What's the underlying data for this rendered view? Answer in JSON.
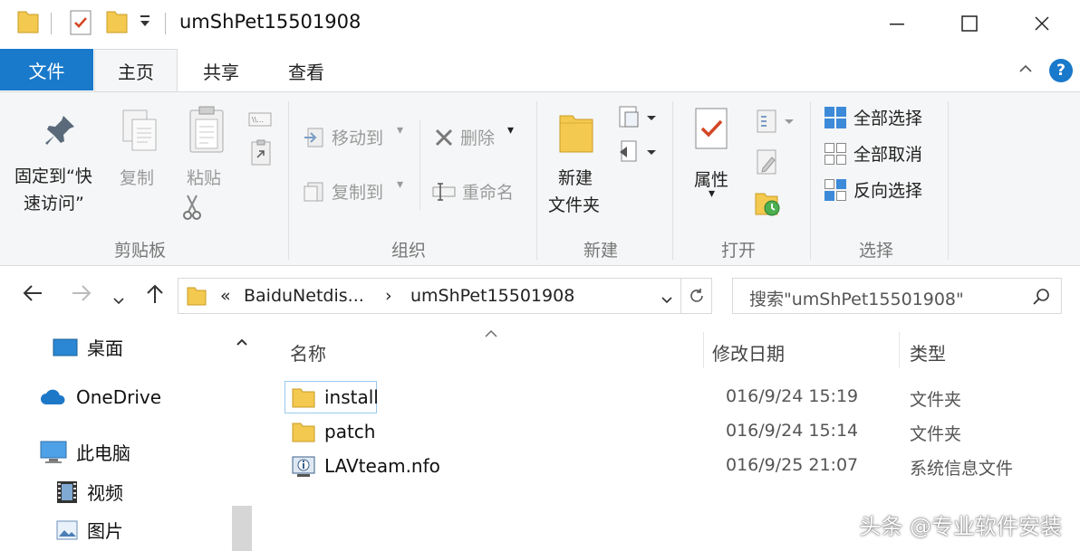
{
  "window": {
    "title": "umShPet15501908"
  },
  "ribbon_tabs": [
    "文件",
    "主页",
    "共享",
    "查看"
  ],
  "ribbon": {
    "clipboard": {
      "pin_label_1": "固定到“快",
      "pin_label_2": "速访问”",
      "copy_label": "复制",
      "paste_label": "粘贴",
      "group_label": "剪贴板"
    },
    "organize": {
      "move_to": "移动到",
      "copy_to": "复制到",
      "delete": "删除",
      "rename": "重命名",
      "group_label": "组织"
    },
    "new": {
      "new_folder_1": "新建",
      "new_folder_2": "文件夹",
      "group_label": "新建"
    },
    "open": {
      "properties": "属性",
      "group_label": "打开"
    },
    "select": {
      "select_all": "全部选择",
      "select_none": "全部取消",
      "invert": "反向选择",
      "group_label": "选择"
    }
  },
  "address": {
    "prefix": "«",
    "crumb1": "BaiduNetdis...",
    "sep": "›",
    "crumb2": "umShPet15501908",
    "search_placeholder": "搜索\"umShPet15501908\""
  },
  "nav_pane": {
    "items": [
      "桌面",
      "OneDrive",
      "此电脑",
      "视频",
      "图片"
    ]
  },
  "columns": {
    "name": "名称",
    "date": "修改日期",
    "type": "类型"
  },
  "files": [
    {
      "name": "install",
      "date": "016/9/24 15:19",
      "type": "文件夹",
      "icon": "folder-icon"
    },
    {
      "name": "patch",
      "date": "016/9/24 15:14",
      "type": "文件夹",
      "icon": "folder-icon"
    },
    {
      "name": "LAVteam.nfo",
      "date": "016/9/25 21:07",
      "type": "系统信息文件",
      "icon": "system-info-file-icon"
    }
  ],
  "watermark": "头条 @专业软件安装",
  "colors": {
    "accent": "#1979ca",
    "folder": "#f3c94f",
    "ribbon_bg": "#f5f6f7"
  }
}
